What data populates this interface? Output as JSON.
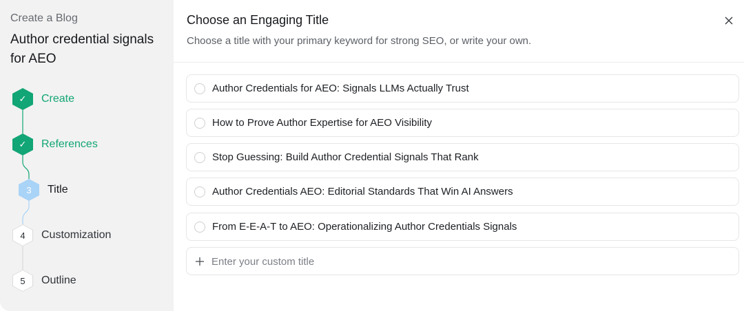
{
  "sidebar": {
    "label": "Create a Blog",
    "topic": "Author credential signals for AEO",
    "steps": [
      {
        "marker": "✓",
        "label": "Create",
        "state": "done"
      },
      {
        "marker": "✓",
        "label": "References",
        "state": "done"
      },
      {
        "marker": "3",
        "label": "Title",
        "state": "active"
      },
      {
        "marker": "4",
        "label": "Customization",
        "state": "todo"
      },
      {
        "marker": "5",
        "label": "Outline",
        "state": "todo"
      }
    ]
  },
  "main": {
    "title": "Choose an Engaging Title",
    "subtitle": "Choose a title with your primary keyword for strong SEO, or write your own.",
    "options": [
      {
        "label": "Author Credentials for AEO: Signals LLMs Actually Trust"
      },
      {
        "label": "How to Prove Author Expertise for AEO Visibility"
      },
      {
        "label": "Stop Guessing: Build Author Credential Signals That Rank"
      },
      {
        "label": "Author Credentials AEO: Editorial Standards That Win AI Answers"
      },
      {
        "label": "From E-E-A-T to AEO: Operationalizing Author Credentials Signals"
      }
    ],
    "custom": {
      "placeholder": "Enter your custom title",
      "value": ""
    }
  },
  "colors": {
    "done": "#12a575",
    "active": "#a9d3f7",
    "sidebar_bg": "#f2f2f2",
    "border": "#e6e6e6"
  },
  "icons": {
    "close": "close-icon",
    "check": "check-icon",
    "plus": "plus-icon"
  }
}
